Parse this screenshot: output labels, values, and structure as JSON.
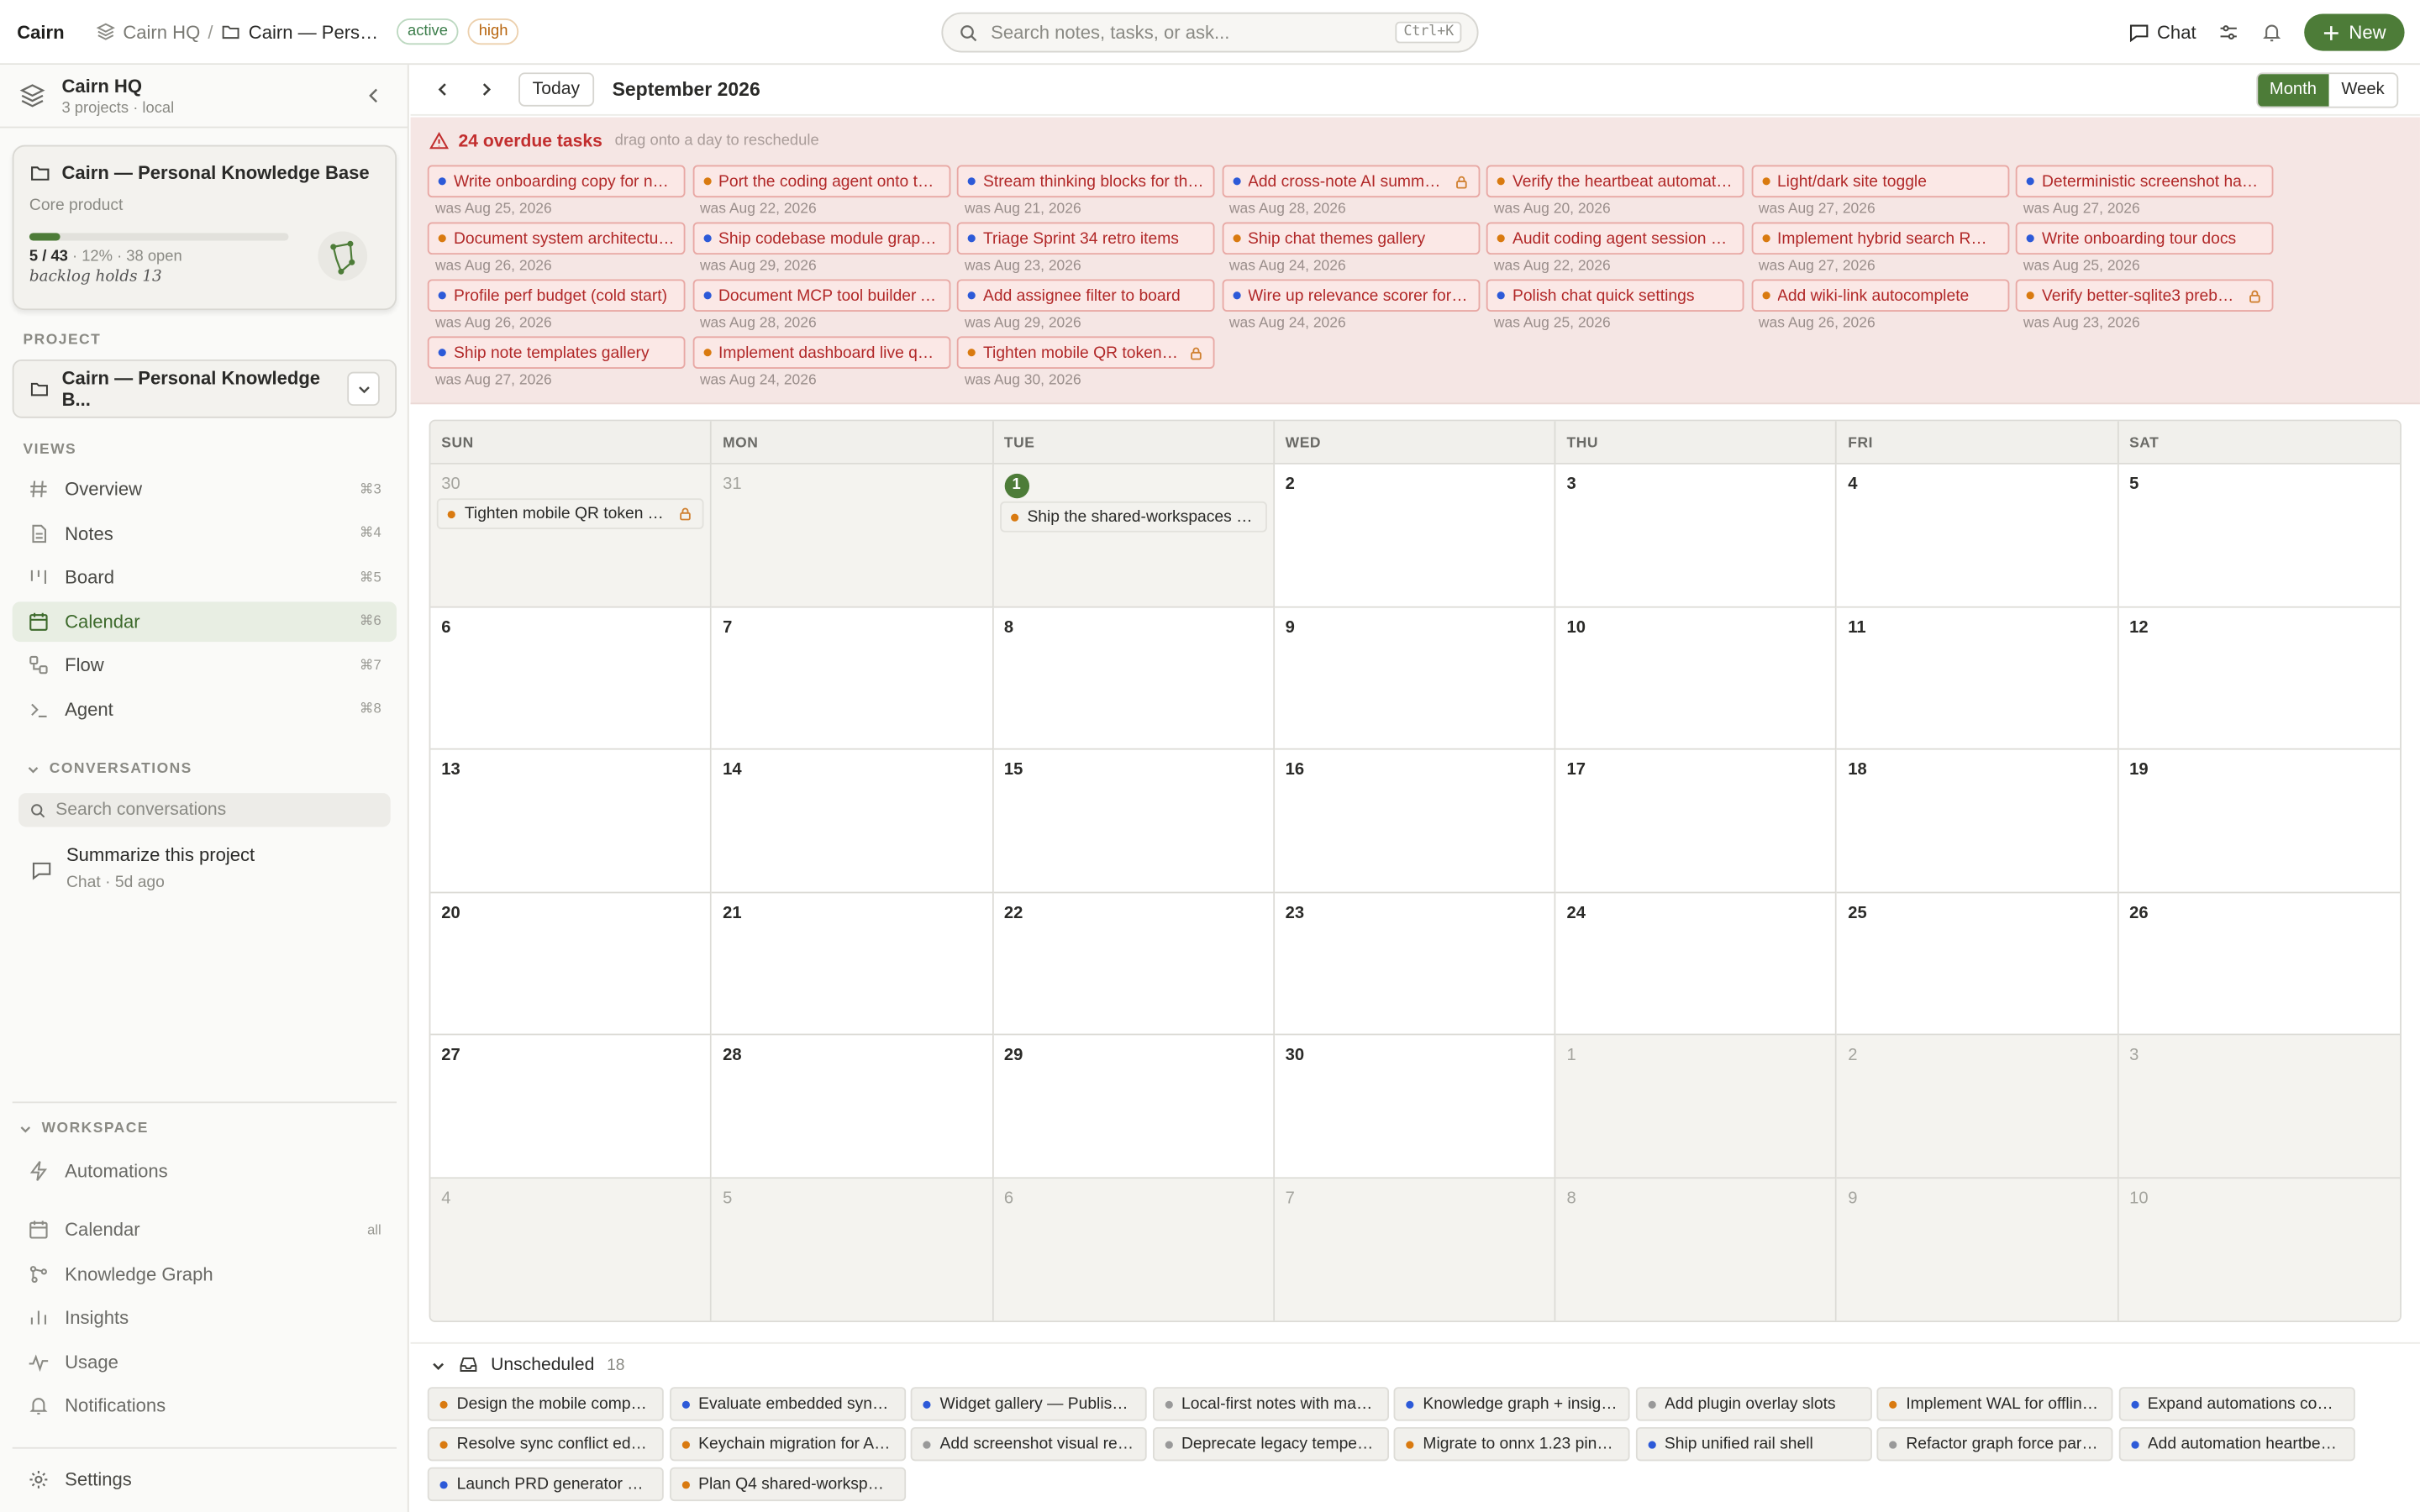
{
  "app": {
    "brand": "Cairn"
  },
  "breadcrumb": {
    "workspace": "Cairn HQ",
    "project": "Cairn — Person...",
    "status": "active",
    "priority": "high"
  },
  "search": {
    "placeholder": "Search notes, tasks, or ask...",
    "shortcut": "Ctrl+K"
  },
  "topbar": {
    "chat_label": "Chat",
    "new_label": "New"
  },
  "workspace": {
    "name": "Cairn HQ",
    "meta": "3 projects · local"
  },
  "project_card": {
    "title": "Cairn — Personal Knowledge Base",
    "subtitle": "Core product",
    "done": "5",
    "total": "43",
    "percent_label": "· 12% · 38 open",
    "progress": 0.12,
    "backlog": "backlog holds 13"
  },
  "sections": {
    "project": "PROJECT",
    "views": "VIEWS",
    "conversations": "CONVERSATIONS",
    "workspace": "WORKSPACE"
  },
  "project_select": {
    "value": "Cairn — Personal Knowledge B..."
  },
  "views": [
    {
      "label": "Overview",
      "shortcut": "⌘3",
      "icon": "hash-icon"
    },
    {
      "label": "Notes",
      "shortcut": "⌘4",
      "icon": "note-icon"
    },
    {
      "label": "Board",
      "shortcut": "⌘5",
      "icon": "board-icon"
    },
    {
      "label": "Calendar",
      "shortcut": "⌘6",
      "icon": "calendar-icon",
      "selected": true
    },
    {
      "label": "Flow",
      "shortcut": "⌘7",
      "icon": "flow-icon"
    },
    {
      "label": "Agent",
      "shortcut": "⌘8",
      "icon": "terminal-icon"
    }
  ],
  "conversations": {
    "search_placeholder": "Search conversations",
    "items": [
      {
        "title": "Summarize this project",
        "kind": "Chat",
        "age": "5d ago"
      }
    ]
  },
  "workspace_nav": [
    {
      "label": "Automations",
      "icon": "bolt-icon"
    },
    {
      "label": "Calendar",
      "icon": "calendar-icon",
      "badge": "all"
    },
    {
      "label": "Knowledge Graph",
      "icon": "graph-icon"
    },
    {
      "label": "Insights",
      "icon": "chart-icon"
    },
    {
      "label": "Usage",
      "icon": "pulse-icon"
    },
    {
      "label": "Notifications",
      "icon": "bell-icon"
    }
  ],
  "settings_label": "Settings",
  "calendar": {
    "today_label": "Today",
    "month_label": "September 2026",
    "views": [
      "Month",
      "Week"
    ],
    "active_view": "Month",
    "weekdays": [
      "SUN",
      "MON",
      "TUE",
      "WED",
      "THU",
      "FRI",
      "SAT"
    ],
    "days": [
      "30",
      "31",
      "1",
      "2",
      "3",
      "4",
      "5",
      "6",
      "7",
      "8",
      "9",
      "10",
      "11",
      "12",
      "13",
      "14",
      "15",
      "16",
      "17",
      "18",
      "19",
      "20",
      "21",
      "22",
      "23",
      "24",
      "25",
      "26",
      "27",
      "28",
      "29",
      "30",
      "1",
      "2",
      "3",
      "4",
      "5",
      "6",
      "7",
      "8",
      "9",
      "10"
    ],
    "today_index": 2
  },
  "events": [
    {
      "day_index": 0,
      "title": "Tighten mobile QR token TTL",
      "color": "orange",
      "locked": true
    },
    {
      "day_index": 2,
      "title": "Ship the shared-workspaces be...",
      "color": "orange",
      "locked": false
    }
  ],
  "overdue": {
    "count_label": "24 overdue tasks",
    "hint": "drag onto a day to reschedule",
    "tasks": [
      {
        "title": "Write onboarding copy for ne...",
        "was": "was Aug 25, 2026",
        "color": "blue"
      },
      {
        "title": "Port the coding agent onto the...",
        "was": "was Aug 22, 2026",
        "color": "orange"
      },
      {
        "title": "Stream thinking blocks for the...",
        "was": "was Aug 21, 2026",
        "color": "blue"
      },
      {
        "title": "Add cross-note AI summari...",
        "was": "was Aug 28, 2026",
        "color": "blue",
        "locked": true
      },
      {
        "title": "Verify the heartbeat automatio...",
        "was": "was Aug 20, 2026",
        "color": "orange"
      },
      {
        "title": "Light/dark site toggle",
        "was": "was Aug 27, 2026",
        "color": "orange"
      },
      {
        "title": "Deterministic screenshot harn...",
        "was": "was Aug 27, 2026",
        "color": "blue"
      },
      {
        "title": "Document system architectur...",
        "was": "was Aug 26, 2026",
        "color": "orange"
      },
      {
        "title": "Ship codebase module graph ...",
        "was": "was Aug 29, 2026",
        "color": "blue"
      },
      {
        "title": "Triage Sprint 34 retro items",
        "was": "was Aug 23, 2026",
        "color": "blue"
      },
      {
        "title": "Ship chat themes gallery",
        "was": "was Aug 24, 2026",
        "color": "orange"
      },
      {
        "title": "Audit coding agent session pe...",
        "was": "was Aug 22, 2026",
        "color": "orange"
      },
      {
        "title": "Implement hybrid search RRF ...",
        "was": "was Aug 27, 2026",
        "color": "orange"
      },
      {
        "title": "Write onboarding tour docs",
        "was": "was Aug 25, 2026",
        "color": "blue"
      },
      {
        "title": "Profile perf budget (cold start)",
        "was": "was Aug 26, 2026",
        "color": "blue"
      },
      {
        "title": "Document MCP tool builder API",
        "was": "was Aug 28, 2026",
        "color": "blue"
      },
      {
        "title": "Add assignee filter to board",
        "was": "was Aug 29, 2026",
        "color": "blue"
      },
      {
        "title": "Wire up relevance scorer for c...",
        "was": "was Aug 24, 2026",
        "color": "blue"
      },
      {
        "title": "Polish chat quick settings",
        "was": "was Aug 25, 2026",
        "color": "blue"
      },
      {
        "title": "Add wiki-link autocomplete",
        "was": "was Aug 26, 2026",
        "color": "orange"
      },
      {
        "title": "Verify better-sqlite3 prebui...",
        "was": "was Aug 23, 2026",
        "color": "orange",
        "locked": true
      },
      {
        "title": "Ship note templates gallery",
        "was": "was Aug 27, 2026",
        "color": "blue"
      },
      {
        "title": "Implement dashboard live que...",
        "was": "was Aug 24, 2026",
        "color": "orange"
      },
      {
        "title": "Tighten mobile QR token T...",
        "was": "was Aug 30, 2026",
        "color": "orange",
        "locked": true
      }
    ]
  },
  "unscheduled": {
    "label": "Unscheduled",
    "count": "18",
    "tasks": [
      {
        "title": "Design the mobile compani...",
        "color": "orange"
      },
      {
        "title": "Evaluate embedded sync e...",
        "color": "blue"
      },
      {
        "title": "Widget gallery — Publish, ...",
        "color": "blue"
      },
      {
        "title": "Local-first notes with mark...",
        "color": "gray"
      },
      {
        "title": "Knowledge graph + insight...",
        "color": "blue"
      },
      {
        "title": "Add plugin overlay slots",
        "color": "gray"
      },
      {
        "title": "Implement WAL for offline ...",
        "color": "orange"
      },
      {
        "title": "Expand automations cookb...",
        "color": "blue"
      },
      {
        "title": "Resolve sync conflict edge...",
        "color": "orange"
      },
      {
        "title": "Keychain migration for API ...",
        "color": "orange"
      },
      {
        "title": "Add screenshot visual regr...",
        "color": "gray"
      },
      {
        "title": "Deprecate legacy temperat...",
        "color": "gray"
      },
      {
        "title": "Migrate to onnx 1.23 pinned",
        "color": "orange"
      },
      {
        "title": "Ship unified rail shell",
        "color": "blue"
      },
      {
        "title": "Refactor graph force para...",
        "color": "gray"
      },
      {
        "title": "Add automation heartbeat ...",
        "color": "blue"
      },
      {
        "title": "Launch PRD generator mo...",
        "color": "blue"
      },
      {
        "title": "Plan Q4 shared-workspace...",
        "color": "orange"
      }
    ]
  }
}
